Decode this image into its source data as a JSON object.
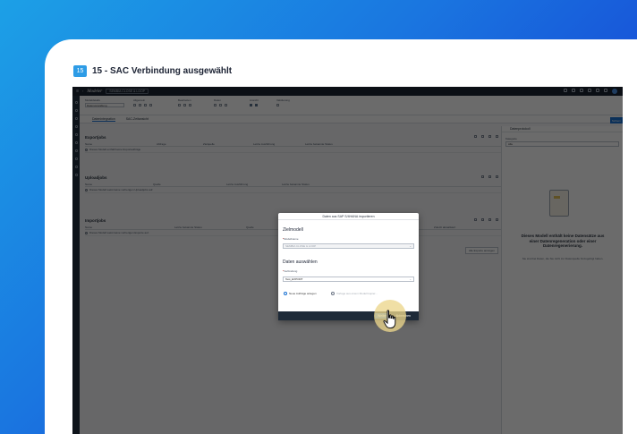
{
  "step": {
    "number": "15",
    "title": "15 - SAC Verbindung ausgewählt"
  },
  "topbar": {
    "brand": "Modeler",
    "model_chip": "SEMBIA CLOSE & LOOP"
  },
  "toolbar": {
    "groups": [
      {
        "label": "Modeldetails",
        "value": "Datenverwaltung"
      },
      {
        "label": "Allgemein"
      },
      {
        "label": "Bearbeiten"
      },
      {
        "label": "Daten"
      },
      {
        "label": "Ansicht"
      },
      {
        "label": "Validierung"
      }
    ],
    "save": "Sichern"
  },
  "tabs": [
    "Datenintegration",
    "SAC-Zeitansicht"
  ],
  "sections": {
    "export": {
      "title": "Exportjobs",
      "columns": [
        "Name",
        "Abfrage",
        "Zielquelle",
        "Letzte Ausführung",
        "Letzte bekannte Status"
      ],
      "message": "Dieses Modell enthält keine Exportaufträge"
    },
    "upload": {
      "title": "Uploadjobs",
      "columns": [
        "Name",
        "Quelle",
        "Letzte Ausführung",
        "Letzte bekannte Status"
      ],
      "message": "Dieses Modell weist keine vorherigen Uploadjobs auf."
    },
    "import": {
      "title": "Importjobs",
      "columns": [
        "Name",
        "Letzte bekannte Status",
        "Quelle",
        "Zuletzt aktualisiert"
      ],
      "message": "Dieses Modell weist keine vorherigen Exporte auf.",
      "side_button": "Alle Exporte anzeigen"
    }
  },
  "right_panel": {
    "title": "Datenprotokoll",
    "kategorie_label": "Kategorie",
    "kategorie_value": "Alle",
    "empty_title": "Dieses Modell enthält keine Datensätze aus einer Datenregeneration oder einer Datenregenerierung.",
    "empty_sub": "Sie sind bei Daten, die Sie nicht zur Datenquelle hinzugefügt haben."
  },
  "dialog": {
    "title": "Daten aus SAP S/4HANA importieren",
    "zielmodell": "Zielmodell",
    "modellname_label": "Modellname",
    "modellname_value": "SEMBIA CLOSE & LOOP",
    "daten_auswaehlen": "Daten auswählen",
    "verbindung_label": "Verbindung",
    "verbindung_value": "Test_EXPORT",
    "radio_new": "Neue Aufträge anlegen",
    "radio_existing": "Vorlage aus einem Modell kopier...",
    "next": "Weiter",
    "cancel": "Abbrechen"
  },
  "colors": {
    "accent": "#1b73d3",
    "step_badge": "#2e9ce6",
    "cursor_halo": "#ecd68c"
  }
}
